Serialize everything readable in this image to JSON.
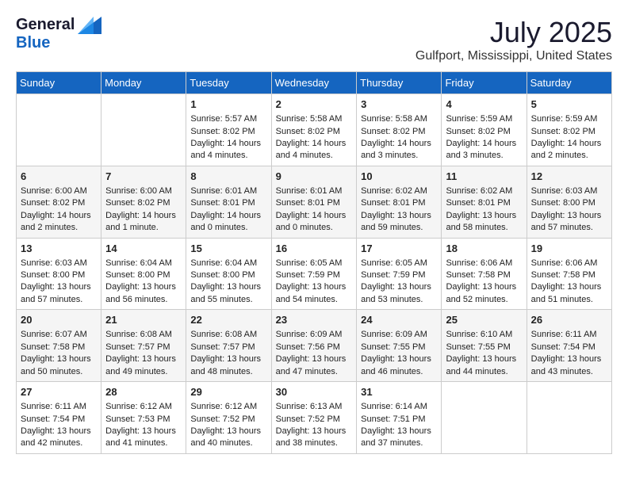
{
  "header": {
    "logo_general": "General",
    "logo_blue": "Blue",
    "title": "July 2025",
    "subtitle": "Gulfport, Mississippi, United States"
  },
  "weekdays": [
    "Sunday",
    "Monday",
    "Tuesday",
    "Wednesday",
    "Thursday",
    "Friday",
    "Saturday"
  ],
  "weeks": [
    [
      {
        "day": "",
        "text": ""
      },
      {
        "day": "",
        "text": ""
      },
      {
        "day": "1",
        "text": "Sunrise: 5:57 AM\nSunset: 8:02 PM\nDaylight: 14 hours and 4 minutes."
      },
      {
        "day": "2",
        "text": "Sunrise: 5:58 AM\nSunset: 8:02 PM\nDaylight: 14 hours and 4 minutes."
      },
      {
        "day": "3",
        "text": "Sunrise: 5:58 AM\nSunset: 8:02 PM\nDaylight: 14 hours and 3 minutes."
      },
      {
        "day": "4",
        "text": "Sunrise: 5:59 AM\nSunset: 8:02 PM\nDaylight: 14 hours and 3 minutes."
      },
      {
        "day": "5",
        "text": "Sunrise: 5:59 AM\nSunset: 8:02 PM\nDaylight: 14 hours and 2 minutes."
      }
    ],
    [
      {
        "day": "6",
        "text": "Sunrise: 6:00 AM\nSunset: 8:02 PM\nDaylight: 14 hours and 2 minutes."
      },
      {
        "day": "7",
        "text": "Sunrise: 6:00 AM\nSunset: 8:02 PM\nDaylight: 14 hours and 1 minute."
      },
      {
        "day": "8",
        "text": "Sunrise: 6:01 AM\nSunset: 8:01 PM\nDaylight: 14 hours and 0 minutes."
      },
      {
        "day": "9",
        "text": "Sunrise: 6:01 AM\nSunset: 8:01 PM\nDaylight: 14 hours and 0 minutes."
      },
      {
        "day": "10",
        "text": "Sunrise: 6:02 AM\nSunset: 8:01 PM\nDaylight: 13 hours and 59 minutes."
      },
      {
        "day": "11",
        "text": "Sunrise: 6:02 AM\nSunset: 8:01 PM\nDaylight: 13 hours and 58 minutes."
      },
      {
        "day": "12",
        "text": "Sunrise: 6:03 AM\nSunset: 8:00 PM\nDaylight: 13 hours and 57 minutes."
      }
    ],
    [
      {
        "day": "13",
        "text": "Sunrise: 6:03 AM\nSunset: 8:00 PM\nDaylight: 13 hours and 57 minutes."
      },
      {
        "day": "14",
        "text": "Sunrise: 6:04 AM\nSunset: 8:00 PM\nDaylight: 13 hours and 56 minutes."
      },
      {
        "day": "15",
        "text": "Sunrise: 6:04 AM\nSunset: 8:00 PM\nDaylight: 13 hours and 55 minutes."
      },
      {
        "day": "16",
        "text": "Sunrise: 6:05 AM\nSunset: 7:59 PM\nDaylight: 13 hours and 54 minutes."
      },
      {
        "day": "17",
        "text": "Sunrise: 6:05 AM\nSunset: 7:59 PM\nDaylight: 13 hours and 53 minutes."
      },
      {
        "day": "18",
        "text": "Sunrise: 6:06 AM\nSunset: 7:58 PM\nDaylight: 13 hours and 52 minutes."
      },
      {
        "day": "19",
        "text": "Sunrise: 6:06 AM\nSunset: 7:58 PM\nDaylight: 13 hours and 51 minutes."
      }
    ],
    [
      {
        "day": "20",
        "text": "Sunrise: 6:07 AM\nSunset: 7:58 PM\nDaylight: 13 hours and 50 minutes."
      },
      {
        "day": "21",
        "text": "Sunrise: 6:08 AM\nSunset: 7:57 PM\nDaylight: 13 hours and 49 minutes."
      },
      {
        "day": "22",
        "text": "Sunrise: 6:08 AM\nSunset: 7:57 PM\nDaylight: 13 hours and 48 minutes."
      },
      {
        "day": "23",
        "text": "Sunrise: 6:09 AM\nSunset: 7:56 PM\nDaylight: 13 hours and 47 minutes."
      },
      {
        "day": "24",
        "text": "Sunrise: 6:09 AM\nSunset: 7:55 PM\nDaylight: 13 hours and 46 minutes."
      },
      {
        "day": "25",
        "text": "Sunrise: 6:10 AM\nSunset: 7:55 PM\nDaylight: 13 hours and 44 minutes."
      },
      {
        "day": "26",
        "text": "Sunrise: 6:11 AM\nSunset: 7:54 PM\nDaylight: 13 hours and 43 minutes."
      }
    ],
    [
      {
        "day": "27",
        "text": "Sunrise: 6:11 AM\nSunset: 7:54 PM\nDaylight: 13 hours and 42 minutes."
      },
      {
        "day": "28",
        "text": "Sunrise: 6:12 AM\nSunset: 7:53 PM\nDaylight: 13 hours and 41 minutes."
      },
      {
        "day": "29",
        "text": "Sunrise: 6:12 AM\nSunset: 7:52 PM\nDaylight: 13 hours and 40 minutes."
      },
      {
        "day": "30",
        "text": "Sunrise: 6:13 AM\nSunset: 7:52 PM\nDaylight: 13 hours and 38 minutes."
      },
      {
        "day": "31",
        "text": "Sunrise: 6:14 AM\nSunset: 7:51 PM\nDaylight: 13 hours and 37 minutes."
      },
      {
        "day": "",
        "text": ""
      },
      {
        "day": "",
        "text": ""
      }
    ]
  ]
}
